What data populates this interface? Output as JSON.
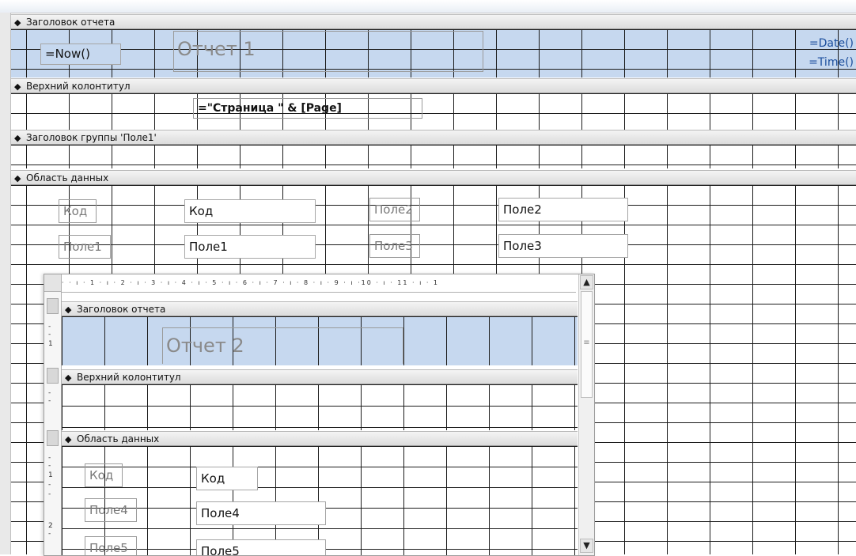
{
  "report1": {
    "sections": {
      "report_header": "Заголовок отчета",
      "page_header": "Верхний колонтитул",
      "group_header": "Заголовок группы 'Поле1'",
      "detail": "Область данных"
    },
    "controls": {
      "now": "=Now()",
      "title": "Отчет 1",
      "date": "=Date()",
      "time": "=Time()",
      "page_expr": "=\"Страница \" & [Page]",
      "kod_label": "Код",
      "kod_field": "Код",
      "pole1_label": "Поле1",
      "pole1_field": "Поле1",
      "pole2_label": "Поле2",
      "pole2_field": "Поле2",
      "pole3_label": "Поле3",
      "pole3_field": "Поле3"
    }
  },
  "report2": {
    "ruler_text": "· · ı · 1 · ı · 2 · ı · 3 · ı · 4 · ı · 5 · ı · 6 · ı · 7 · ı · 8 · ı · 9 · ı ·10 · ı · 11 · ı · 1",
    "vertical_ticks": [
      "1",
      "1",
      "2"
    ],
    "sections": {
      "report_header": "Заголовок отчета",
      "page_header": "Верхний колонтитул",
      "detail": "Область данных"
    },
    "controls": {
      "title": "Отчет 2",
      "kod_label": "Код",
      "kod_field": "Код",
      "pole4_label": "Поле4",
      "pole4_field": "Поле4",
      "pole5_label": "Поле5",
      "pole5_field": "Поле5"
    }
  },
  "icons": {
    "section_arrow": "◆",
    "scroll_up": "▲",
    "scroll_down": "▼",
    "thumb_grip": "≡"
  },
  "colors": {
    "header_fill": "#c6d8ef",
    "grid_line": "#1c1c1c",
    "formula_text": "#1a4d9c"
  }
}
